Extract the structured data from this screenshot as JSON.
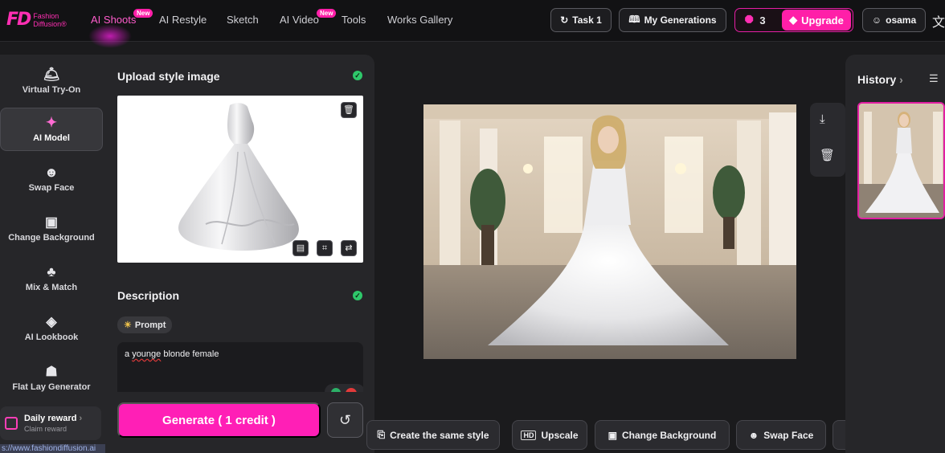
{
  "brand": {
    "mark": "FD",
    "line1": "Fashion",
    "line2": "Diffusion®"
  },
  "nav": {
    "items": [
      {
        "label": "AI Shoots",
        "badge": "New"
      },
      {
        "label": "AI Restyle"
      },
      {
        "label": "Sketch"
      },
      {
        "label": "AI Video",
        "badge": "New"
      },
      {
        "label": "Tools"
      },
      {
        "label": "Works Gallery"
      }
    ],
    "task_label": "Task 1",
    "generations_label": "My Generations",
    "credits": "3",
    "upgrade_label": "Upgrade",
    "user_name": "osama",
    "language_icon": "translate-icon"
  },
  "sidebar": {
    "items": [
      {
        "label": "Virtual Try-On",
        "icon": "hanger-icon"
      },
      {
        "label": "AI Model",
        "icon": "sparkle-person-icon",
        "active": true
      },
      {
        "label": "Swap Face",
        "icon": "face-swap-icon"
      },
      {
        "label": "Change Background",
        "icon": "background-icon"
      },
      {
        "label": "Mix & Match",
        "icon": "shirt-icon"
      },
      {
        "label": "AI Lookbook",
        "icon": "lookbook-icon"
      },
      {
        "label": "Flat Lay Generator",
        "icon": "flat-lay-icon"
      }
    ],
    "daily_reward": {
      "title": "Daily reward",
      "subtitle": "Claim reward"
    },
    "status_url": "s://www.fashiondiffusion.ai"
  },
  "panel": {
    "upload_title": "Upload style image",
    "description_title": "Description",
    "prompt_chip": "Prompt",
    "description_text_misspelled": "younge",
    "description_text_a": "a",
    "description_text_rest": "blonde female",
    "generate_label": "Generate ( 1 credit )"
  },
  "actions": [
    {
      "label": "Create the same style",
      "icon": "copy-style-icon"
    },
    {
      "label": "Upscale",
      "icon": "hd-icon"
    },
    {
      "label": "Change Background",
      "icon": "background-icon"
    },
    {
      "label": "Swap Face",
      "icon": "face-swap-icon"
    }
  ],
  "history": {
    "title": "History",
    "chevron": "›"
  },
  "colors": {
    "accent": "#ff1fb6",
    "success": "#2ec86a",
    "background": "#1b1b1d"
  }
}
